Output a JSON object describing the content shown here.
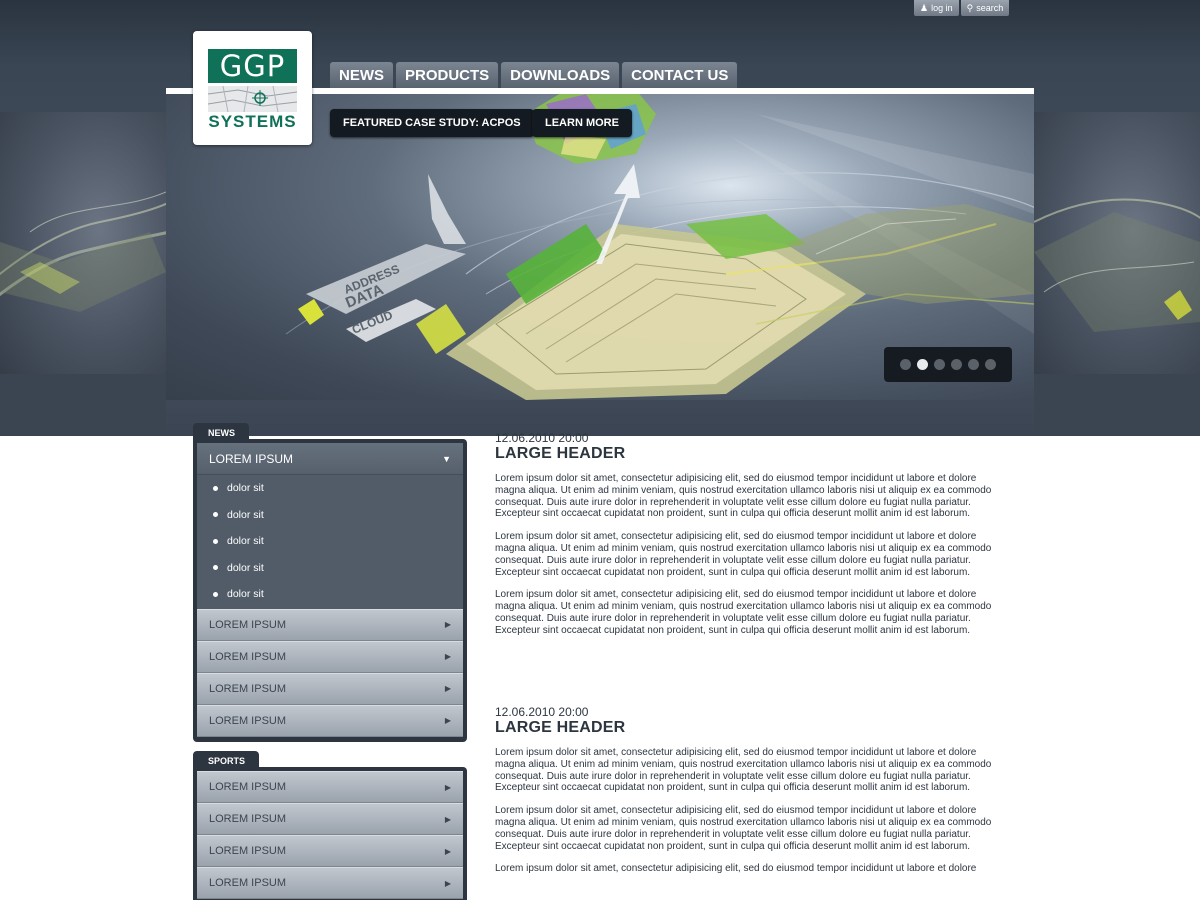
{
  "utility": {
    "login_label": "log in",
    "search_label": "search",
    "login_icon": "users-icon",
    "search_icon": "magnifier-icon"
  },
  "logo": {
    "top_text": "GGP",
    "bottom_text": "SYSTEMS",
    "brand_color": "#0f7158"
  },
  "nav": {
    "items": [
      "NEWS",
      "PRODUCTS",
      "DOWNLOADS",
      "CONTACT US"
    ]
  },
  "hero": {
    "featured_label": "FEATURED CASE STUDY: ACPOS",
    "learn_more_label": "LEARN MORE",
    "art_text": [
      "ADDRESS",
      "DATA",
      "CLOUD"
    ],
    "slides_count": 6,
    "active_slide": 2
  },
  "sidebar": {
    "news": {
      "tab_label": "NEWS",
      "open_item": "LOREM IPSUM",
      "sub_items": [
        "dolor sit",
        "dolor sit",
        "dolor sit",
        "dolor sit",
        "dolor sit"
      ],
      "items": [
        "LOREM IPSUM",
        "LOREM IPSUM",
        "LOREM IPSUM",
        "LOREM IPSUM"
      ]
    },
    "sports": {
      "tab_label": "SPORTS",
      "items": [
        "LOREM IPSUM",
        "LOREM IPSUM",
        "LOREM IPSUM",
        "LOREM IPSUM"
      ]
    }
  },
  "articles": [
    {
      "date": "12.06.2010 20:00",
      "title": "LARGE HEADER",
      "paragraphs": [
        "Lorem ipsum dolor sit amet, consectetur adipisicing elit, sed do eiusmod tempor incididunt ut labore et dolore magna aliqua. Ut enim ad minim veniam, quis nostrud exercitation ullamco laboris nisi ut aliquip ex ea commodo consequat. Duis aute irure dolor in reprehenderit in voluptate velit esse cillum dolore eu fugiat nulla pariatur. Excepteur sint occaecat cupidatat non proident, sunt in culpa qui officia deserunt mollit anim id est laborum.",
        "Lorem ipsum dolor sit amet, consectetur adipisicing elit, sed do eiusmod tempor incididunt ut labore et dolore magna aliqua. Ut enim ad minim veniam, quis nostrud exercitation ullamco laboris nisi ut aliquip ex ea commodo consequat. Duis aute irure dolor in reprehenderit in voluptate velit esse cillum dolore eu fugiat nulla pariatur. Excepteur sint occaecat cupidatat non proident, sunt in culpa qui officia deserunt mollit anim id est laborum.",
        "Lorem ipsum dolor sit amet, consectetur adipisicing elit, sed do eiusmod tempor incididunt ut labore et dolore magna aliqua. Ut enim ad minim veniam, quis nostrud exercitation ullamco laboris nisi ut aliquip ex ea commodo consequat. Duis aute irure dolor in reprehenderit in voluptate velit esse cillum dolore eu fugiat nulla pariatur. Excepteur sint occaecat cupidatat non proident, sunt in culpa qui officia deserunt mollit anim id est laborum."
      ]
    },
    {
      "date": "12.06.2010 20:00",
      "title": "LARGE HEADER",
      "paragraphs": [
        "Lorem ipsum dolor sit amet, consectetur adipisicing elit, sed do eiusmod tempor incididunt ut labore et dolore magna aliqua. Ut enim ad minim veniam, quis nostrud exercitation ullamco laboris nisi ut aliquip ex ea commodo consequat. Duis aute irure dolor in reprehenderit in voluptate velit esse cillum dolore eu fugiat nulla pariatur. Excepteur sint occaecat cupidatat non proident, sunt in culpa qui officia deserunt mollit anim id est laborum.",
        "Lorem ipsum dolor sit amet, consectetur adipisicing elit, sed do eiusmod tempor incididunt ut labore et dolore magna aliqua. Ut enim ad minim veniam, quis nostrud exercitation ullamco laboris nisi ut aliquip ex ea commodo consequat. Duis aute irure dolor in reprehenderit in voluptate velit esse cillum dolore eu fugiat nulla pariatur. Excepteur sint occaecat cupidatat non proident, sunt in culpa qui officia deserunt mollit anim id est laborum.",
        "Lorem ipsum dolor sit amet, consectetur adipisicing elit, sed do eiusmod tempor incididunt ut labore et dolore"
      ]
    }
  ],
  "colors": {
    "dark": "#2d3640",
    "menu_light": "#b0b7bf",
    "nav_tab": "#6a7480"
  }
}
